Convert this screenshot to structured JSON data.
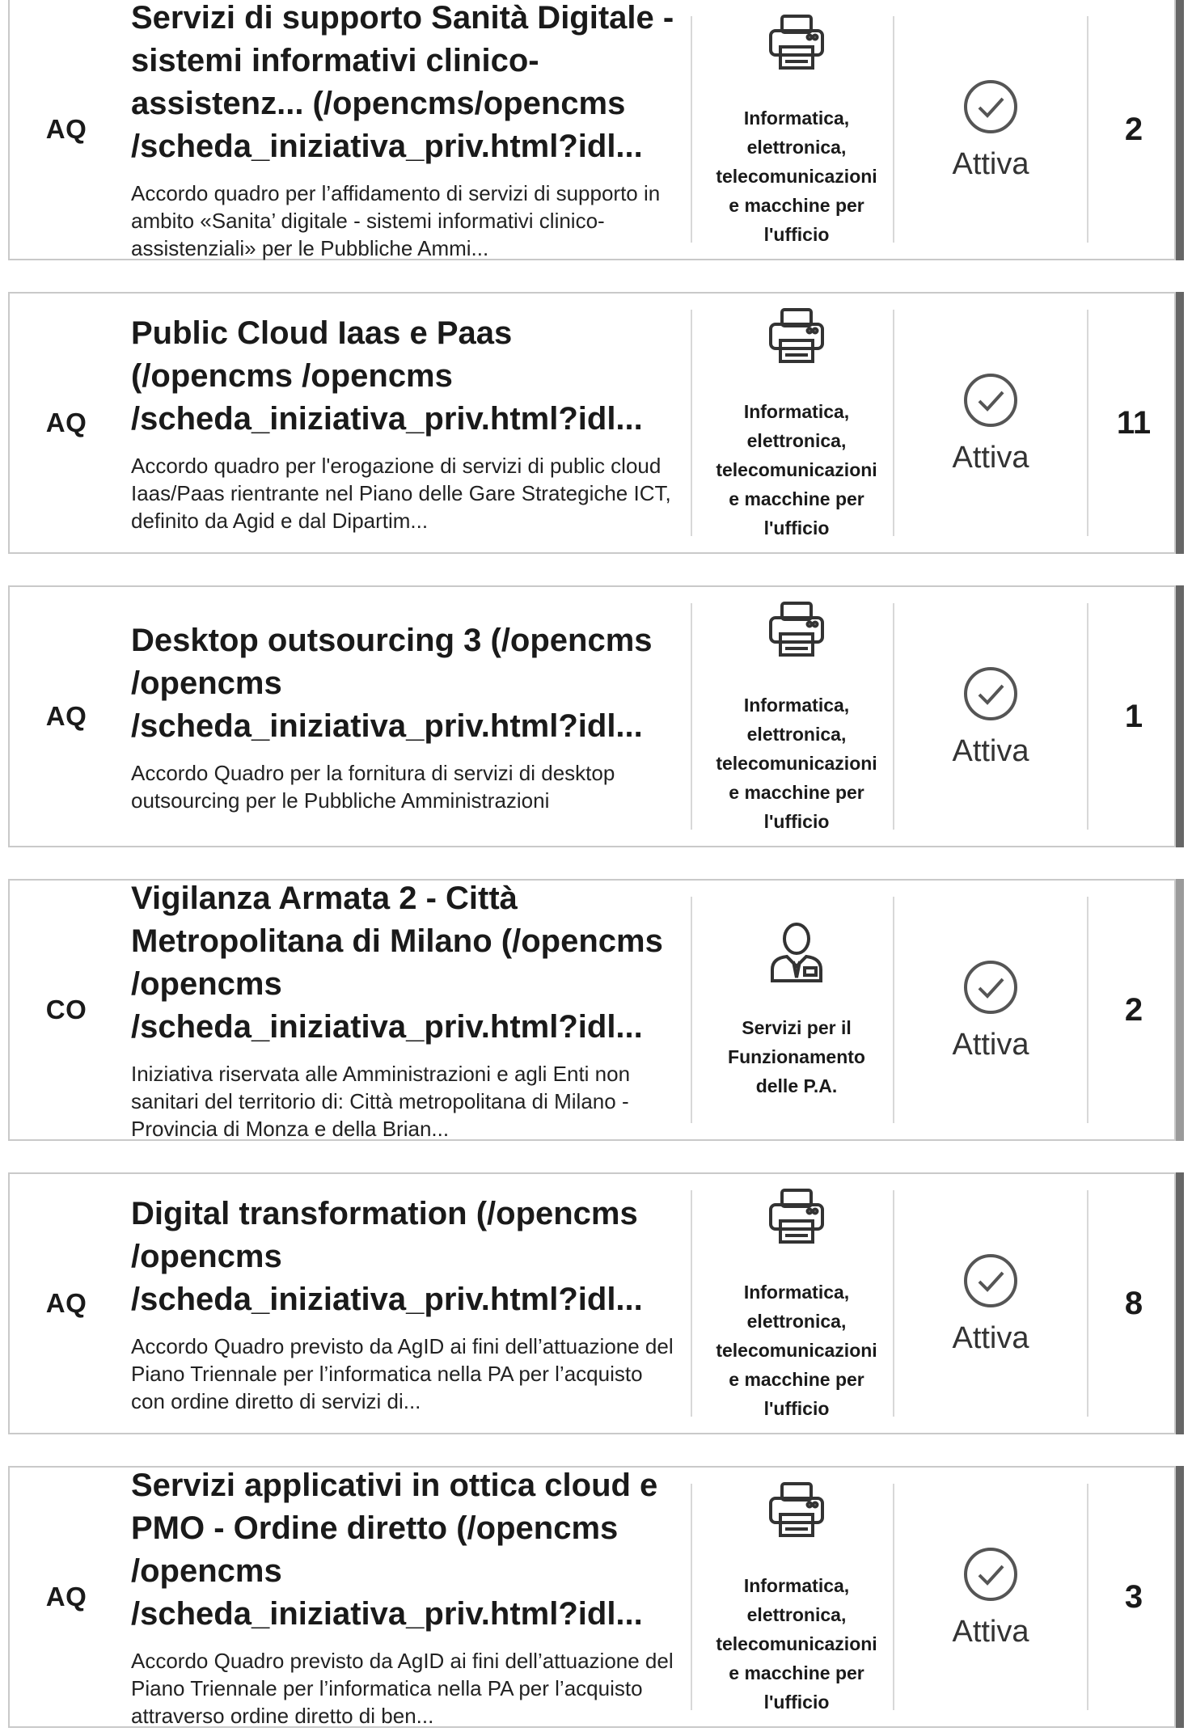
{
  "status_icon": "check-circle-icon",
  "items": [
    {
      "type": "AQ",
      "title": "Servizi di supporto Sanità Digitale - sistemi informativi clinico-assistenz... (/opencms/opencms /scheda_iniziativa_priv.html?idl...",
      "description": "Accordo quadro per l’affidamento di servizi di supporto in ambito «Sanita’ digitale - sistemi informativi clinico-assistenziali» per le Pubbliche Ammi...",
      "category": "Informatica, elettronica, telecomunicazioni e macchine per l'ufficio",
      "category_icon": "printer-icon",
      "status": "Attiva",
      "count": "2"
    },
    {
      "type": "AQ",
      "title": "Public Cloud Iaas e Paas (/opencms /opencms /scheda_iniziativa_priv.html?idl...",
      "description": "Accordo quadro per l'erogazione di servizi di public cloud Iaas/Paas rientrante nel Piano delle Gare Strategiche ICT, definito da Agid e dal Dipartim...",
      "category": "Informatica, elettronica, telecomunicazioni e macchine per l'ufficio",
      "category_icon": "printer-icon",
      "status": "Attiva",
      "count": "11"
    },
    {
      "type": "AQ",
      "title": "Desktop outsourcing 3 (/opencms /opencms /scheda_iniziativa_priv.html?idl...",
      "description": "Accordo Quadro per la fornitura di servizi di desktop outsourcing per le Pubbliche Amministrazioni",
      "category": "Informatica, elettronica, telecomunicazioni e macchine per l'ufficio",
      "category_icon": "printer-icon",
      "status": "Attiva",
      "count": "1"
    },
    {
      "type": "CO",
      "title": "Vigilanza Armata 2 - Città Metropolitana di Milano (/opencms /opencms /scheda_iniziativa_priv.html?idl...",
      "description": "Iniziativa riservata alle Amministrazioni e agli Enti non sanitari del territorio di: Città metropolitana di Milano - Provincia di Monza e della Brian...",
      "category": "Servizi per il Funzionamento delle P.A.",
      "category_icon": "person-icon",
      "status": "Attiva",
      "count": "2"
    },
    {
      "type": "AQ",
      "title": "Digital transformation (/opencms /opencms /scheda_iniziativa_priv.html?idl...",
      "description": "Accordo Quadro previsto da AgID ai fini dell’attuazione del Piano Triennale per l’informatica nella PA per l’acquisto con ordine diretto di servizi di...",
      "category": "Informatica, elettronica, telecomunicazioni e macchine per l'ufficio",
      "category_icon": "printer-icon",
      "status": "Attiva",
      "count": "8"
    },
    {
      "type": "AQ",
      "title": "Servizi applicativi in ottica cloud e PMO - Ordine diretto (/opencms /opencms /scheda_iniziativa_priv.html?idl...",
      "description": "Accordo Quadro previsto da AgID ai fini dell’attuazione del Piano Triennale per l’informatica nella PA per l’acquisto attraverso ordine diretto di ben...",
      "category": "Informatica, elettronica, telecomunicazioni e macchine per l'ufficio",
      "category_icon": "printer-icon",
      "status": "Attiva",
      "count": "3"
    }
  ]
}
